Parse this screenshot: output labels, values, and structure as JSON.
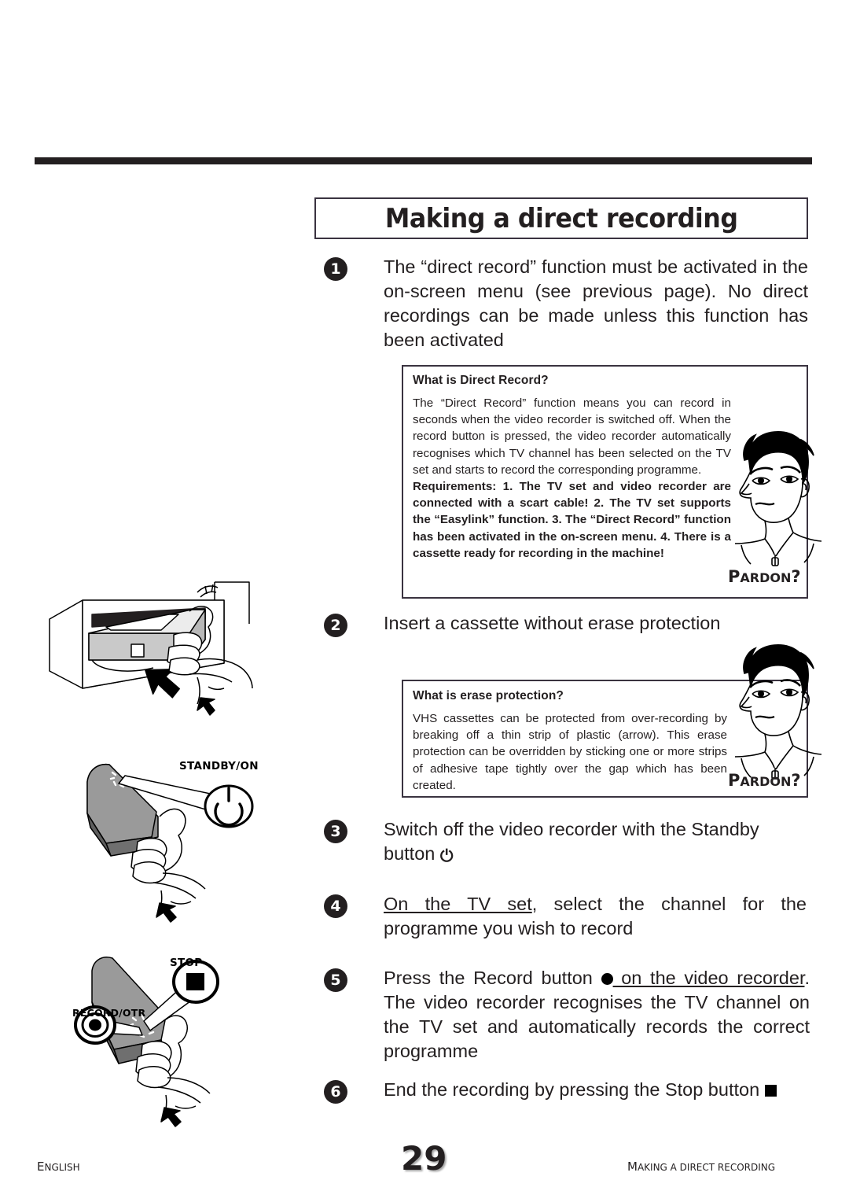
{
  "page": {
    "title": "Making a direct recording",
    "number": "29",
    "footer_left": "English",
    "footer_right": "Making a direct recording"
  },
  "steps": [
    {
      "number": "1",
      "text": "The “direct record” function must be activated in the on-screen menu (see previous page). No direct recordings can be made unless this function has been activated"
    },
    {
      "number": "2",
      "text": "Insert a cassette without erase protection"
    },
    {
      "number": "3",
      "text_before": "Switch off the video recorder with the Standby button ",
      "icon": "power-icon"
    },
    {
      "number": "4",
      "underlined": "On the TV set",
      "text_after": ", select the channel for the programme you wish to record"
    },
    {
      "number": "5",
      "text_a": "Press the Record button ",
      "icon": "record-dot-icon",
      "underlined": " on the video recorder",
      "text_b": ". The video recorder recognises the TV channel on the TV set and automatically records the correct programme"
    },
    {
      "number": "6",
      "text_before": "End the recording by pressing the Stop button ",
      "icon": "stop-square-icon"
    }
  ],
  "info_boxes": [
    {
      "title": "What is Direct Record?",
      "body": "The “Direct Record” function means you can record in seconds when the video recorder is switched off. When the record button is pressed, the video recorder automatically recognises which TV channel has been selected on the TV set and starts to record the corresponding programme.",
      "body_bold": "Requirements: 1. The TV set and video recorder are connected with a scart cable! 2. The TV set supports the “Easylink” function. 3. The “Direct Record” function has been activated in the on-screen menu. 4. There is a cassette ready for recording in the machine!",
      "pardon_first": "P",
      "pardon_rest": "ARDON",
      "pardon_mark": "?"
    },
    {
      "title": "What is erase protection?",
      "body": "VHS cassettes can be protected from over-recording by breaking off a thin strip of plastic (arrow). This erase protection can be overridden by sticking one or more strips of adhesive tape tightly over the gap which has been created.",
      "pardon_first": "P",
      "pardon_rest": "ARDON",
      "pardon_mark": "?"
    }
  ],
  "illustrations": [
    {
      "name": "cassette-insertion",
      "labels": []
    },
    {
      "name": "remote-standby",
      "labels": [
        "STANDBY/ON"
      ]
    },
    {
      "name": "remote-record-stop",
      "labels": [
        "STOP",
        "RECORD/OTR"
      ]
    }
  ]
}
